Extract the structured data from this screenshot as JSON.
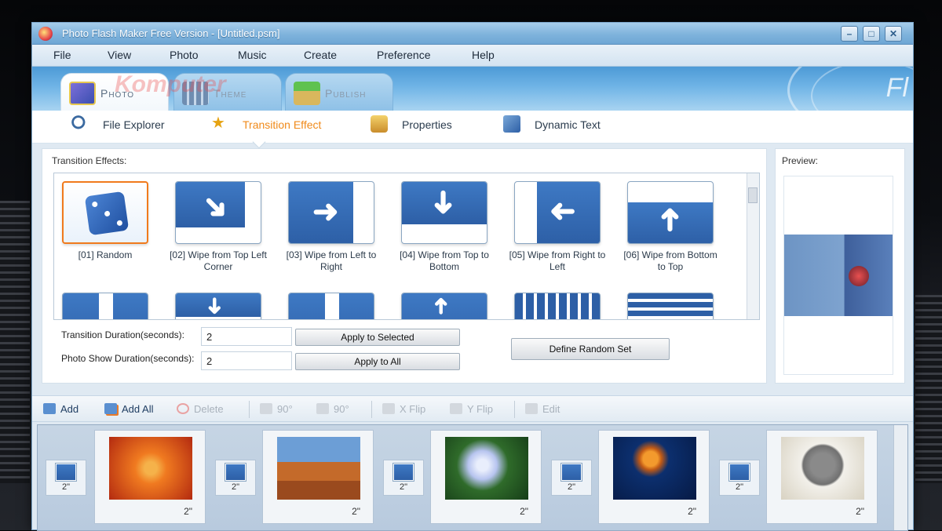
{
  "window": {
    "title": "Photo Flash Maker Free Version - [Untitled.psm]"
  },
  "menu": [
    "File",
    "View",
    "Photo",
    "Music",
    "Create",
    "Preference",
    "Help"
  ],
  "tabs": [
    {
      "label": "Photo",
      "active": true
    },
    {
      "label": "Theme",
      "active": false
    },
    {
      "label": "Publish",
      "active": false
    }
  ],
  "watermark": "Komputer",
  "subtabs": [
    {
      "label": "File Explorer",
      "icon": "magnifier-icon",
      "active": false
    },
    {
      "label": "Transition Effect",
      "icon": "star-icon",
      "active": true
    },
    {
      "label": "Properties",
      "icon": "properties-icon",
      "active": false
    },
    {
      "label": "Dynamic Text",
      "icon": "dynamic-text-icon",
      "active": false
    }
  ],
  "effects_panel": {
    "label": "Transition Effects:",
    "effects": [
      {
        "label": "[01] Random",
        "selected": true
      },
      {
        "label": "[02] Wipe from Top Left Corner",
        "selected": false
      },
      {
        "label": "[03] Wipe from Left to Right",
        "selected": false
      },
      {
        "label": "[04] Wipe from Top to Bottom",
        "selected": false
      },
      {
        "label": "[05] Wipe from Right to Left",
        "selected": false
      },
      {
        "label": "[06] Wipe from Bottom to Top",
        "selected": false
      }
    ],
    "transition_duration_label": "Transition Duration(seconds):",
    "transition_duration_value": "2",
    "photo_duration_label": "Photo Show Duration(seconds):",
    "photo_duration_value": "2",
    "apply_selected": "Apply to Selected",
    "apply_all": "Apply to All",
    "define_random": "Define Random Set"
  },
  "preview": {
    "label": "Preview:"
  },
  "photo_toolbar": {
    "add": "Add",
    "add_all": "Add All",
    "delete": "Delete",
    "rotate_left": "90°",
    "rotate_right": "90°",
    "x_flip": "X Flip",
    "y_flip": "Y Flip",
    "edit": "Edit"
  },
  "strip": {
    "transitions": [
      "2\"",
      "2\"",
      "2\"",
      "2\"",
      "2\""
    ],
    "photos": [
      {
        "name": "flower",
        "duration": "2\"",
        "colors": [
          "#f07a20",
          "#b32a10"
        ]
      },
      {
        "name": "desert",
        "duration": "2\"",
        "colors": [
          "#6c9ed6",
          "#9a4a1e"
        ]
      },
      {
        "name": "hydrangea",
        "duration": "2\"",
        "colors": [
          "#2f6b2a",
          "#b7c4ef"
        ]
      },
      {
        "name": "jellyfish",
        "duration": "2\"",
        "colors": [
          "#0c2f6e",
          "#f39a2d"
        ]
      },
      {
        "name": "koala",
        "duration": "2\"",
        "colors": [
          "#f2f0ea",
          "#707070"
        ]
      }
    ]
  }
}
